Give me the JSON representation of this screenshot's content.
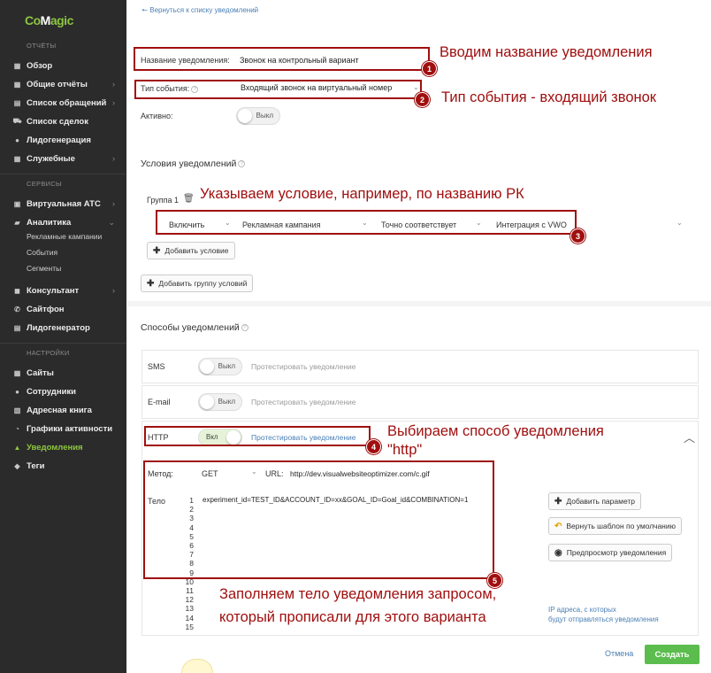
{
  "sidebar": {
    "logo": "CoMagic",
    "sections": {
      "reports": "ОТЧЁТЫ",
      "services": "СЕРВИСЫ",
      "settings": "НАСТРОЙКИ"
    },
    "reports_items": [
      "Обзор",
      "Общие отчёты",
      "Список обращений",
      "Список сделок",
      "Лидогенерация",
      "Служебные"
    ],
    "services_items": [
      "Виртуальная АТС",
      "Аналитика",
      "Консультант",
      "Сайтфон",
      "Лидогенератор"
    ],
    "analytics_sub": [
      "Рекламные кампании",
      "События",
      "Сегменты"
    ],
    "settings_items": [
      "Сайты",
      "Сотрудники",
      "Адресная книга",
      "Графики активности",
      "Уведомления",
      "Теги"
    ]
  },
  "back_link": "Вернуться к списку уведомлений",
  "form": {
    "name_label": "Название уведомления:",
    "name_value": "Звонок на контрольный вариант",
    "event_label": "Тип события:",
    "event_value": "Входящий звонок на виртуальный номер",
    "active_label": "Активно:",
    "active_state": "Выкл"
  },
  "conditions": {
    "title": "Условия уведомлений",
    "group_label": "Группа 1",
    "row": [
      "Включить",
      "Рекламная кампания",
      "Точно соответствует",
      "Интеграция с VWO"
    ],
    "add_condition": "Добавить условие",
    "add_group": "Добавить группу условий"
  },
  "methods": {
    "title": "Способы уведомлений",
    "sms_label": "SMS",
    "email_label": "E-mail",
    "http_label": "HTTP",
    "off": "Выкл",
    "on": "Вкл",
    "test": "Протестировать уведомление",
    "method_label": "Метод:",
    "method_value": "GET",
    "url_label": "URL:",
    "url_value": "http://dev.visualwebsiteoptimizer.com/c.gif",
    "body_label": "Тело",
    "body_value": "experiment_id=TEST_ID&ACCOUNT_ID=xx&GOAL_ID=Goal_id&COMBINATION=1",
    "line_numbers": [
      "1",
      "2",
      "3",
      "4",
      "5",
      "6",
      "7",
      "8",
      "9",
      "10",
      "11",
      "12",
      "13",
      "14",
      "15"
    ],
    "add_param": "Добавить параметр",
    "reset_template": "Вернуть шаблон по умолчанию",
    "preview": "Предпросмотр уведомления",
    "ip_note_line1": "IP адреса, с которых",
    "ip_note_line2": "будут отправляться уведомления"
  },
  "footer": {
    "cancel": "Отмена",
    "save": "Создать"
  },
  "annotations": {
    "a1": "Вводим название уведомления",
    "a2": "Тип события - входящий звонок",
    "a3": "Указываем условие, например, по названию РК",
    "a4_line1": "Выбираем способ уведомления",
    "a4_line2": "\"http\"",
    "a5_line1": "Заполняем тело уведомления запросом,",
    "a5_line2": "который прописали для этого варианта",
    "badges": [
      "1",
      "2",
      "3",
      "4",
      "5"
    ]
  },
  "colors": {
    "sidebar_bg": "#2b2b2b",
    "brand_green": "#8cc63f",
    "annotation_red": "#a00f0f",
    "save_green": "#5bbd4d",
    "link_blue": "#4a7fb5"
  }
}
